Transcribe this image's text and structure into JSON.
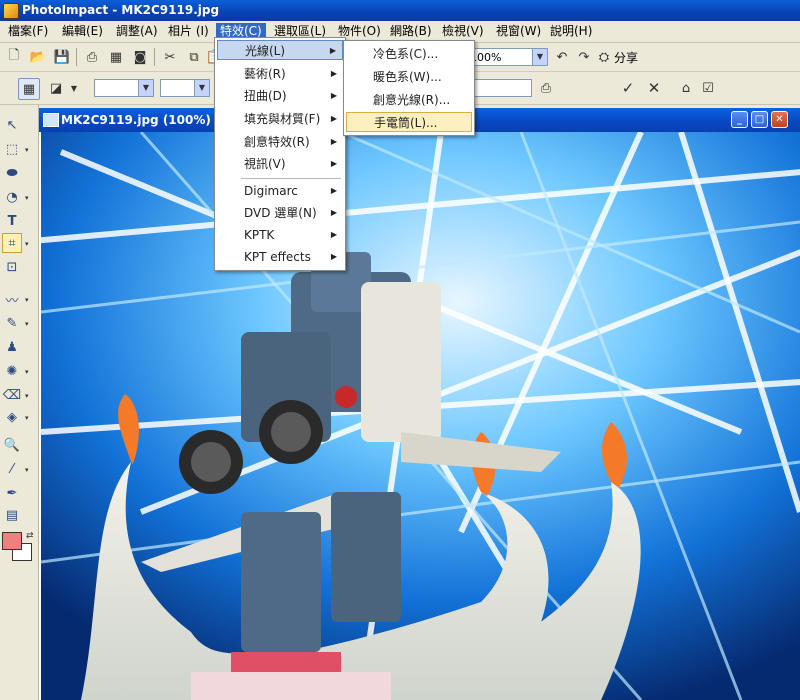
{
  "window": {
    "title": "PhotoImpact - MK2C9119.jpg"
  },
  "menubar": {
    "items": [
      {
        "label": "檔案(F)"
      },
      {
        "label": "編輯(E)"
      },
      {
        "label": "調整(A)"
      },
      {
        "label": "相片 (I)"
      },
      {
        "label": "特效(C)"
      },
      {
        "label": "選取區(L)"
      },
      {
        "label": "物件(O)"
      },
      {
        "label": "網路(B)"
      },
      {
        "label": "檢視(V)"
      },
      {
        "label": "視窗(W)"
      },
      {
        "label": "說明(H)"
      }
    ]
  },
  "toolbar": {
    "zoom_value": "100%",
    "share_label": "分享"
  },
  "document": {
    "title": "MK2C9119.jpg (100%) 800x"
  },
  "effects_menu": {
    "items": [
      {
        "label": "光線(L)"
      },
      {
        "label": "藝術(R)"
      },
      {
        "label": "扭曲(D)"
      },
      {
        "label": "填充與材質(F)"
      },
      {
        "label": "創意特效(R)"
      },
      {
        "label": "視訊(V)"
      },
      {
        "label": "Digimarc"
      },
      {
        "label": "DVD 選單(N)"
      },
      {
        "label": "KPTK"
      },
      {
        "label": "KPT effects"
      }
    ]
  },
  "lighting_submenu": {
    "items": [
      {
        "label": "冷色系(C)..."
      },
      {
        "label": "暖色系(W)..."
      },
      {
        "label": "創意光線(R)..."
      },
      {
        "label": "手電筒(L)..."
      }
    ]
  },
  "colors": {
    "titlebar": "#0842b4",
    "menu_highlight": "#316ac5",
    "foreground_swatch": "#f08080",
    "background_swatch": "#ffffff"
  },
  "icons": [
    "new-file-icon",
    "open-folder-icon",
    "save-icon",
    "scan-icon",
    "grid-icon",
    "camera-icon",
    "cut-icon",
    "copy-icon",
    "paste-icon",
    "undo-icon",
    "redo-icon",
    "ok-icon",
    "cancel-icon",
    "arrow-select-icon",
    "lasso-icon",
    "shape-icon",
    "text-icon",
    "crop-icon",
    "transform-icon",
    "brush-icon",
    "stamp-icon",
    "eraser-icon",
    "zoom-icon",
    "eyedropper-icon"
  ]
}
